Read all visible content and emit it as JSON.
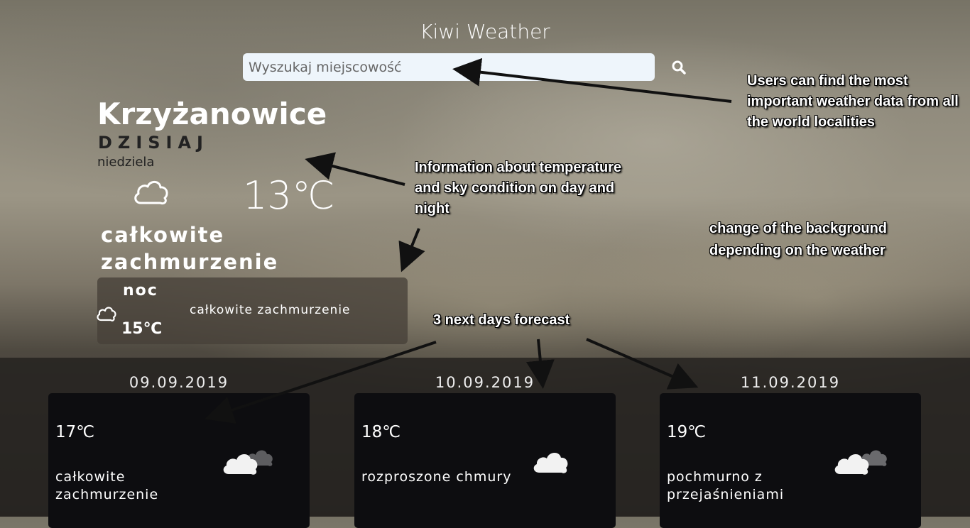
{
  "app": {
    "title": "Kiwi Weather"
  },
  "search": {
    "placeholder": "Wyszukaj miejscowość"
  },
  "today": {
    "city": "Krzyżanowice",
    "label": "DZISIAJ",
    "weekday": "niedziela",
    "temperature": "13℃",
    "condition": "całkowite zachmurzenie",
    "icon": "cloud-outline-icon"
  },
  "night": {
    "label": "noc",
    "temperature": "15℃",
    "condition": "całkowite zachmurzenie",
    "icon": "cloud-moon-outline-icon"
  },
  "forecast": [
    {
      "date": "09.09.2019",
      "temperature": "17℃",
      "condition": "całkowite zachmurzenie",
      "icon": "cloud-overcast-icon"
    },
    {
      "date": "10.09.2019",
      "temperature": "18℃",
      "condition": "rozproszone chmury",
      "icon": "cloud-icon"
    },
    {
      "date": "11.09.2019",
      "temperature": "19℃",
      "condition": "pochmurno z przejaśnieniami",
      "icon": "cloud-broken-icon"
    }
  ],
  "annotations": {
    "search_note": "Users can find the most important weather data from all the world localities",
    "temp_note": "Information about temperature and sky condition on day and night",
    "background_note": "change of the background depending on the weather",
    "forecast_note": "3 next days forecast"
  },
  "colors": {
    "search_bg": "#eef5fb",
    "card_bg": "#0d0d10",
    "night_panel": "#464039"
  }
}
